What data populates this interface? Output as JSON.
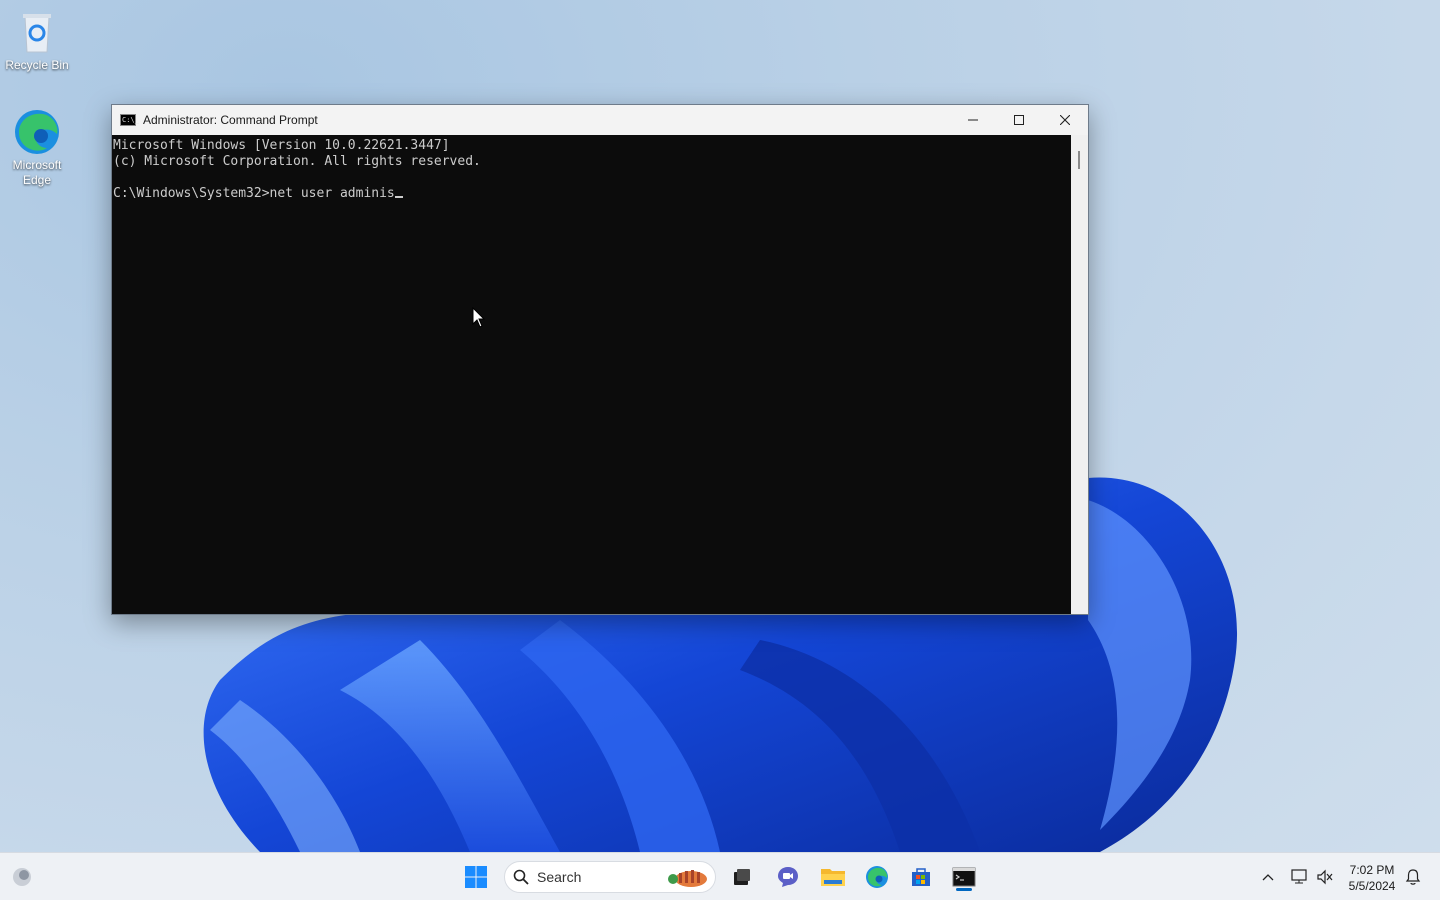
{
  "desktop": {
    "icons": [
      {
        "label": "Recycle Bin"
      },
      {
        "label": "Microsoft Edge"
      }
    ]
  },
  "window": {
    "title": "Administrator: Command Prompt",
    "icon_label": "C:\\_",
    "console_lines": [
      "Microsoft Windows [Version 10.0.22621.3447]",
      "(c) Microsoft Corporation. All rights reserved.",
      "",
      "C:\\Windows\\System32>net user adminis"
    ]
  },
  "taskbar": {
    "search_label": "Search",
    "apps": [
      "start-icon",
      "search-icon",
      "task-view-icon",
      "chat-icon",
      "file-explorer-icon",
      "edge-icon",
      "store-icon",
      "terminal-icon"
    ],
    "active_app": "terminal-icon",
    "clock": {
      "time": "7:02 PM",
      "date": "5/5/2024"
    },
    "tray": [
      "chevron-up-icon",
      "network-icon",
      "volume-icon",
      "notification-icon"
    ]
  },
  "colors": {
    "console_bg": "#0c0c0c",
    "console_fg": "#cccccc",
    "accent": "#0067c0"
  }
}
